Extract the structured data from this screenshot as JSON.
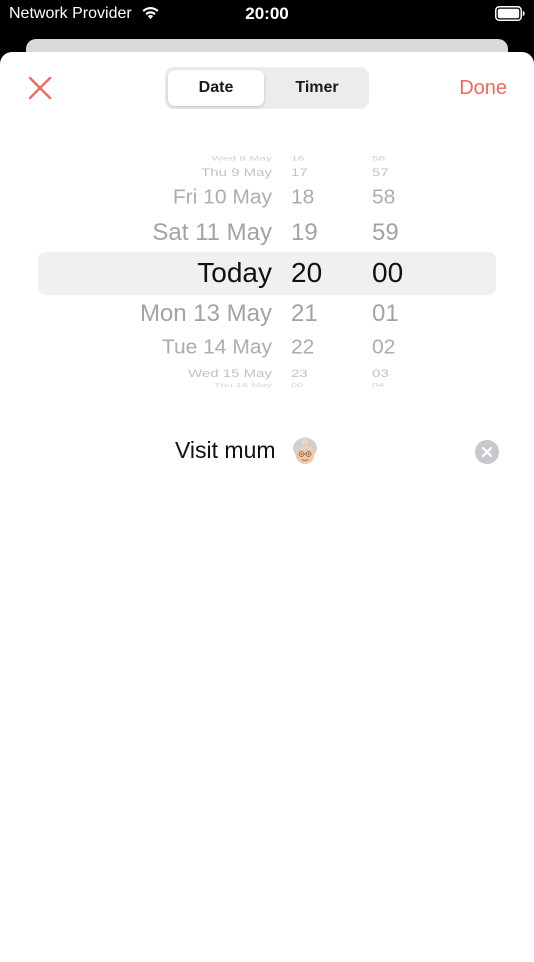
{
  "status": {
    "carrier": "Network Provider",
    "time": "20:00",
    "icons": [
      "wifi-icon",
      "battery-icon"
    ]
  },
  "header": {
    "close_icon": "close-icon",
    "segments": [
      {
        "label": "Date",
        "selected": true
      },
      {
        "label": "Timer",
        "selected": false
      }
    ],
    "done_label": "Done"
  },
  "picker": {
    "rows": [
      {
        "day": "Wed 8 May",
        "hour": "16",
        "minute": "56"
      },
      {
        "day": "Thu 9 May",
        "hour": "17",
        "minute": "57"
      },
      {
        "day": "Fri 10 May",
        "hour": "18",
        "minute": "58"
      },
      {
        "day": "Sat 11 May",
        "hour": "19",
        "minute": "59"
      },
      {
        "day": "Today",
        "hour": "20",
        "minute": "00"
      },
      {
        "day": "Mon 13 May",
        "hour": "21",
        "minute": "01"
      },
      {
        "day": "Tue 14 May",
        "hour": "22",
        "minute": "02"
      },
      {
        "day": "Wed 15 May",
        "hour": "23",
        "minute": "03"
      },
      {
        "day": "Thu 16 May",
        "hour": "00",
        "minute": "04"
      }
    ],
    "selected_index": 4
  },
  "note": {
    "text": "Visit mum",
    "emoji_icon": "older-woman-emoji-icon",
    "clear_icon": "clear-icon"
  },
  "colors": {
    "accent": "#ee6a5c",
    "segment_bg": "#ececec",
    "highlight_bg": "#f0f0f0"
  }
}
